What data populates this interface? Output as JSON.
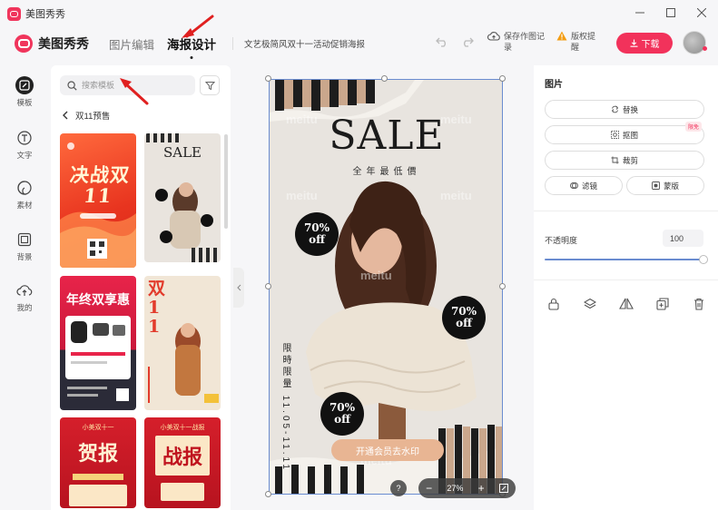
{
  "window": {
    "title": "美图秀秀"
  },
  "nav": {
    "brand": "美图秀秀",
    "tabs": [
      "图片编辑",
      "海报设计"
    ],
    "active_tab": "海报设计",
    "doc_title": "文艺极简风双十一活动促销海报",
    "save_label": "保存作图记录",
    "rights_label": "版权提醒",
    "download_label": "下载"
  },
  "rail": {
    "items": [
      {
        "label": "模板",
        "icon": "template-icon",
        "active": true
      },
      {
        "label": "文字",
        "icon": "text-icon",
        "active": false
      },
      {
        "label": "素材",
        "icon": "material-icon",
        "active": false
      },
      {
        "label": "背景",
        "icon": "background-icon",
        "active": false
      },
      {
        "label": "我的",
        "icon": "upload-icon",
        "active": false
      }
    ]
  },
  "templates": {
    "search_placeholder": "搜索模板",
    "breadcrumb": "双11预售",
    "items": [
      {
        "main": "决战双11",
        "style": "red-festive"
      },
      {
        "main": "SALE",
        "style": "beige-stripe"
      },
      {
        "main": "年终双享惠",
        "style": "red-gift"
      },
      {
        "main": "双11",
        "style": "cream-red"
      },
      {
        "main": "贺报",
        "sub": "小美双十一",
        "style": "red-report"
      },
      {
        "main": "战报",
        "sub": "小美双十一战报",
        "style": "red-report"
      }
    ]
  },
  "poster": {
    "headline": "SALE",
    "subtitle": "全年最低價",
    "watermark": "meitu",
    "badges": [
      "70%",
      "70%",
      "70%"
    ],
    "badge_off": "off",
    "vertical_text": "限時限量 11.05-11.11",
    "cta": "开通会员去水印"
  },
  "zoom": {
    "level": "27%",
    "help": "?"
  },
  "props": {
    "title": "图片",
    "buttons": {
      "replace": "替换",
      "cutout": "抠图",
      "crop": "裁剪",
      "filter": "滤镜",
      "mask": "蒙版"
    },
    "cutout_badge": "限免",
    "opacity_label": "不透明度",
    "opacity_value": "100",
    "opacity": 1.0,
    "tools": [
      "lock-icon",
      "layers-icon",
      "flip-icon",
      "duplicate-icon",
      "delete-icon"
    ]
  },
  "colors": {
    "accent": "#f2325b",
    "selection": "#6a8cd0",
    "cta": "#e8b593"
  }
}
